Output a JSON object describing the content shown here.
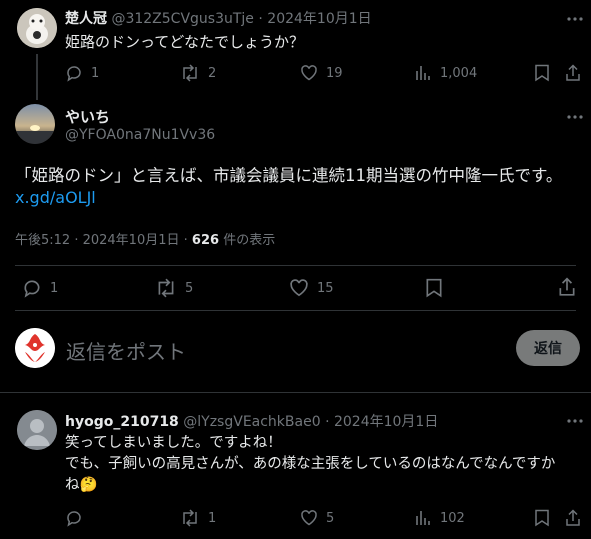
{
  "parent_post": {
    "display_name": "楚人冠",
    "handle": "@312Z5CVgus3uTje",
    "date": "2024年10月1日",
    "text": "姫路のドンってどなたでしょうか？",
    "replies": "1",
    "reposts": "2",
    "likes": "19",
    "views": "1,004"
  },
  "main_post": {
    "display_name": "やいち",
    "handle": "@YFOA0na7Nu1Vv36",
    "text": "「姫路のドン」と言えば、市議会議員に連続11期当選の竹中隆一氏です。",
    "link": "x.gd/aOLJl",
    "time": "午後5:12 · 2024年10月1日 ·",
    "views_count": "626",
    "views_label": "件の表示",
    "replies": "1",
    "reposts": "5",
    "likes": "15"
  },
  "reply_box": {
    "placeholder": "返信をポスト",
    "button_label": "返信"
  },
  "reply_post": {
    "display_name": "hyogo_210718",
    "handle": "@lYzsgVEachkBae0",
    "date": "2024年10月1日",
    "line1": "笑ってしまいました。ですよね！",
    "line2": "でも、子飼いの高見さんが、あの様な主張をしているのはなんでなんですか",
    "line3": "ね🤔",
    "replies": "",
    "reposts": "1",
    "likes": "5",
    "views": "102"
  }
}
